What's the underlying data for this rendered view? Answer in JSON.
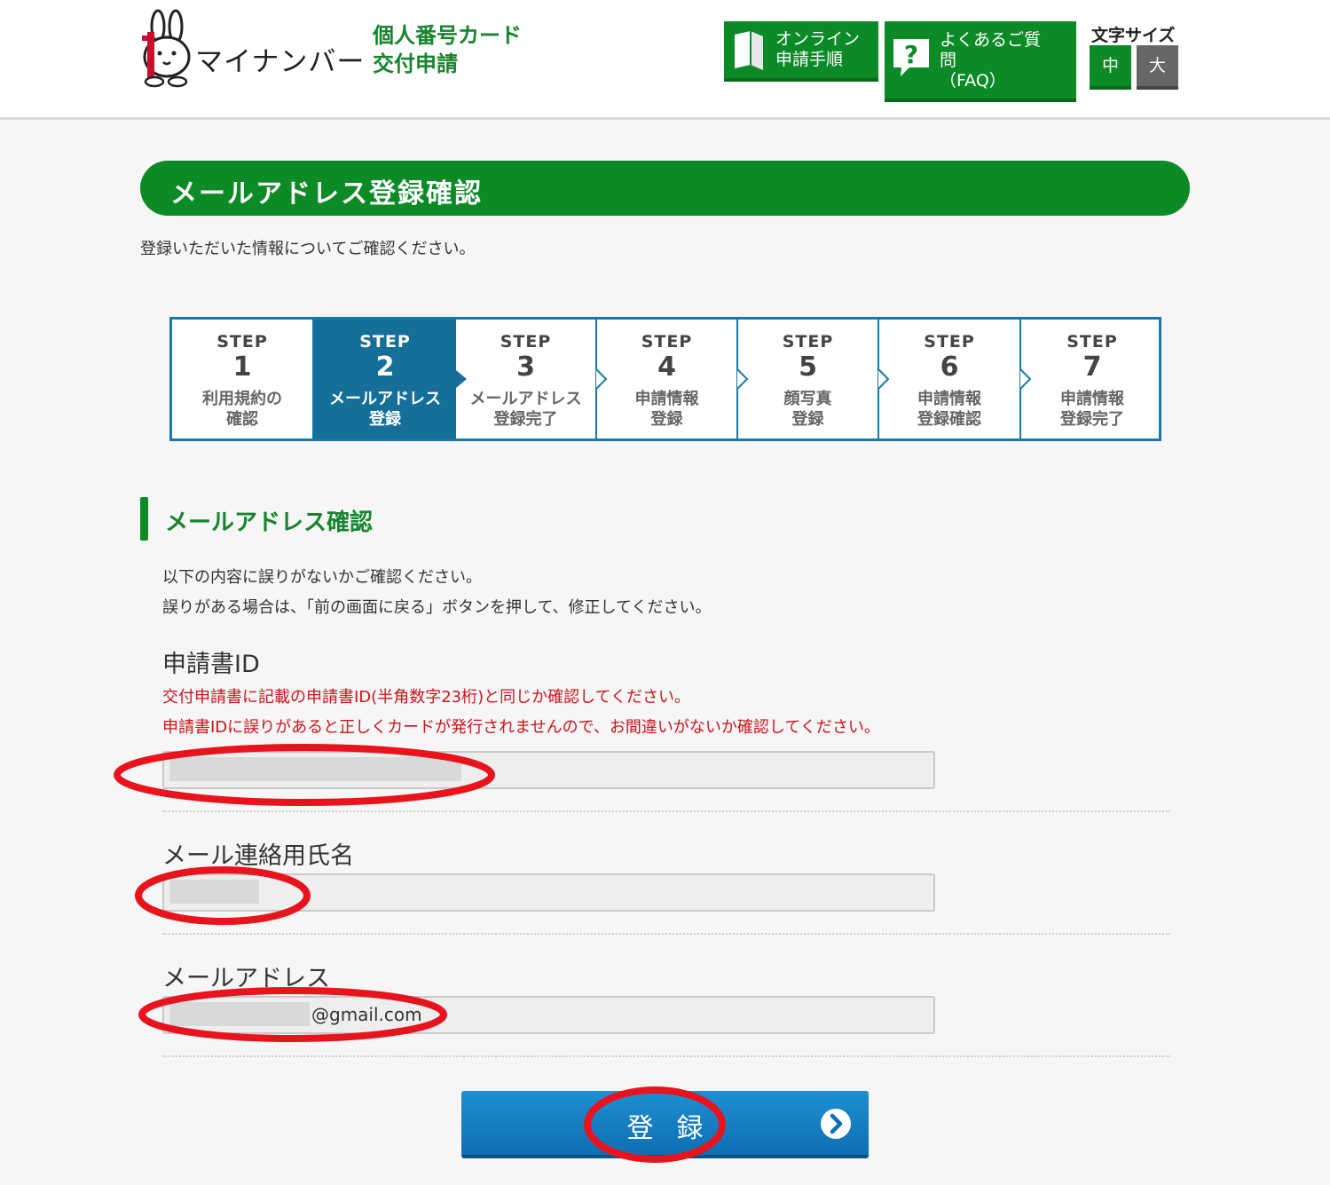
{
  "header": {
    "logo_text": "マイナンバー",
    "site_title_line1": "個人番号カード",
    "site_title_line2": "交付申請",
    "online_btn_line1": "オンライン",
    "online_btn_line2": "申請手順",
    "faq_btn_line1": "よくあるご質",
    "faq_btn_line2": "問",
    "faq_btn_line3": "（FAQ）",
    "font_size_label": "文字サイズ",
    "font_size_medium": "中",
    "font_size_large": "大"
  },
  "page": {
    "title": "メールアドレス登録確認",
    "intro": "登録いただいた情報についてご確認ください。"
  },
  "steps": [
    {
      "word": "STEP",
      "num": "1",
      "label1": "利用規約の",
      "label2": "確認",
      "active": false
    },
    {
      "word": "STEP",
      "num": "2",
      "label1": "メールアドレス",
      "label2": "登録",
      "active": true
    },
    {
      "word": "STEP",
      "num": "3",
      "label1": "メールアドレス",
      "label2": "登録完了",
      "active": false
    },
    {
      "word": "STEP",
      "num": "4",
      "label1": "申請情報",
      "label2": "登録",
      "active": false
    },
    {
      "word": "STEP",
      "num": "5",
      "label1": "顔写真",
      "label2": "登録",
      "active": false
    },
    {
      "word": "STEP",
      "num": "6",
      "label1": "申請情報",
      "label2": "登録確認",
      "active": false
    },
    {
      "word": "STEP",
      "num": "7",
      "label1": "申請情報",
      "label2": "登録完了",
      "active": false
    }
  ],
  "section": {
    "title": "メールアドレス確認",
    "note1": "以下の内容に誤りがないかご確認ください。",
    "note2": "誤りがある場合は、「前の画面に戻る」ボタンを押して、修正してください。"
  },
  "fields": {
    "app_id_label": "申請書ID",
    "app_id_warn1": "交付申請書に記載の申請書ID(半角数字23桁)と同じか確認してください。",
    "app_id_warn2": "申請書IDに誤りがあると正しくカードが発行されませんので、お間違いがないか確認してください。",
    "name_label": "メール連絡用氏名",
    "email_label": "メールアドレス",
    "email_value": "@gmail.com"
  },
  "submit": {
    "label": "登録"
  },
  "colors": {
    "green": "#0b8a26",
    "step_blue": "#166f99",
    "button_blue": "#1583c7",
    "warning_red": "#d0121b",
    "annotation_red": "#e8141d"
  }
}
